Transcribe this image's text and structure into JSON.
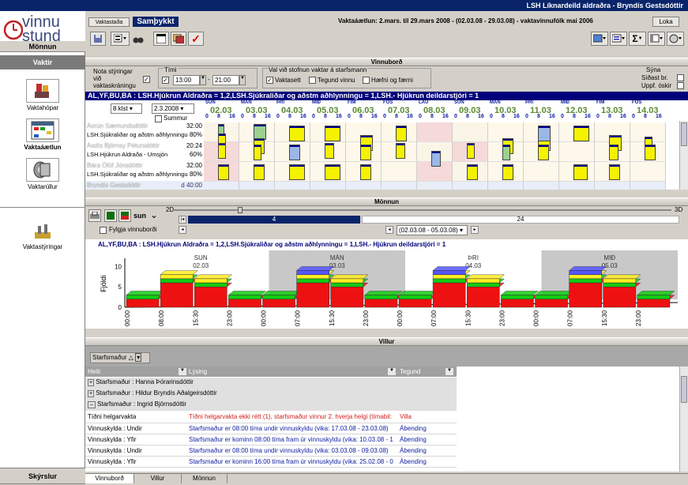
{
  "title": "LSH Líknardeild aldraðra - Bryndís Gestsdóttir",
  "logo": {
    "line1": "vinnu",
    "line2": "stund"
  },
  "nav": {
    "head1": "Mönnun",
    "head2": "Vaktir",
    "items": [
      {
        "label": "Vaktahópar",
        "icon": "people-icon"
      },
      {
        "label": "Vaktaáætlun",
        "icon": "calendar-icon"
      },
      {
        "label": "Vaktarúllur",
        "icon": "roll-icon"
      },
      {
        "label": "Vaktastýringar",
        "icon": "settings-icon"
      }
    ],
    "footer": "Skýrslur"
  },
  "toolbar": {
    "tab_vaktastada": "Vaktastaða",
    "tab_sambykkt": "Samþykkt",
    "plan_info": "Vaktaáætlun: 2.mars. til 29.mars 2008 - (02.03.08 - 29.03.08) - vaktavinnufólk mai 2006",
    "loka": "Loka"
  },
  "vinnubord": {
    "title": "Vinnuborð",
    "nota_styringar": "Nota stýringar við vaktaskráningu",
    "timi_label": "Tími",
    "time_from": "13:00",
    "time_to": "21:00",
    "val_label": "Val við stofnun vaktar á starfsmann",
    "vaktasett": "Vaktasett",
    "tegund_vinnu": "Tegund vinnu",
    "haefni": "Hæfni og færni",
    "syna_label": "Sýna",
    "sidast": "Síðast br.",
    "uppf": "Uppf. óskir",
    "bluebar": "AL,YF,BU,BA : LSH.Hjúkrun Aldraðra = 1,2,LSH.Sjúkraliðar og aðstm aðhlynningu = 1,LSH.- Hjúkrun deildarstjóri = 1",
    "period": "8 klst",
    "date": "2.3.2008",
    "summur": "Summur",
    "days": [
      {
        "d": "SUN",
        "n": "02.03"
      },
      {
        "d": "MÁN",
        "n": "03.03"
      },
      {
        "d": "ÞRI",
        "n": "04.03"
      },
      {
        "d": "MIÐ",
        "n": "05.03"
      },
      {
        "d": "FIM",
        "n": "06.03"
      },
      {
        "d": "FÖS",
        "n": "07.03"
      },
      {
        "d": "LAU",
        "n": "08.03"
      },
      {
        "d": "SUN",
        "n": "09.03"
      },
      {
        "d": "MÁN",
        "n": "10.03"
      },
      {
        "d": "ÞRI",
        "n": "11.03"
      },
      {
        "d": "MIÐ",
        "n": "12.03"
      },
      {
        "d": "FIM",
        "n": "13.03"
      },
      {
        "d": "FÖS",
        "n": "14.03"
      }
    ],
    "rows": [
      {
        "name": "Ásrún Sæmundsdóttir",
        "hours": "32:00",
        "group": "LSH.Sjúkraliðar og aðstm aðhlynningu",
        "pct": "80%"
      },
      {
        "name": "Ásdís Björnsy Pétursdóttir",
        "hours": "20:24",
        "group": "LSH.Hjúkrun Aldraða - Umsjón",
        "pct": "60%"
      },
      {
        "name": "Bára Ólöf Jónsdóttir",
        "hours": "32:00",
        "group": "LSH.Sjúkraliðar og aðstm aðhlynningu",
        "pct": "80%"
      },
      {
        "name": "Bryndís Gestsdóttir",
        "hours": "d 40:00",
        "group": "",
        "pct": ""
      }
    ]
  },
  "monnun": {
    "title": "Mönnun",
    "sun_label": "sun",
    "slider_min": "2D",
    "slider_max": "3D",
    "num_a": "4",
    "num_b": "24",
    "fylgja": "Fylgja vinnuborði",
    "range": "(02.03.08 - 05.03.08)",
    "chart_title": "AL,YF,BU,BA : LSH.Hjúkrun Aldraðra = 1,2,LSH.Sjúkraliðar og aðstm aðhlynningu = 1,LSH.- Hjúkrun deildarstjóri = 1",
    "ylabel": "Fjöldi",
    "yticks": [
      "0",
      "5",
      "10"
    ],
    "xticks": [
      "00:00",
      "08:00",
      "15:30",
      "23:00",
      "00:00",
      "07:00",
      "15:30",
      "23:00",
      "00:00",
      "07:00",
      "15:30",
      "23:00",
      "00:00",
      "07:00",
      "15:30",
      "23:00"
    ]
  },
  "chart_data": {
    "type": "area",
    "title": "AL,YF,BU,BA : LSH.Hjúkrun Aldraðra = 1,2,LSH.Sjúkraliðar og aðstm aðhlynningu = 1,LSH.- Hjúkrun deildarstjóri = 1",
    "ylabel": "Fjöldi",
    "ylim": [
      0,
      12
    ],
    "days": [
      {
        "d": "SUN",
        "n": "02.03"
      },
      {
        "d": "MÁN",
        "n": "03.03"
      },
      {
        "d": "ÞRI",
        "n": "04.03"
      },
      {
        "d": "MIÐ",
        "n": "05.03"
      }
    ],
    "series": [
      {
        "values": [
          2,
          6,
          5,
          2,
          2,
          6,
          5,
          2,
          2,
          6,
          5,
          2,
          2,
          6,
          5,
          2
        ]
      },
      {
        "values": [
          1,
          1,
          1,
          1,
          1,
          1,
          1,
          1,
          1,
          1,
          1,
          1,
          1,
          1,
          1,
          1
        ]
      },
      {
        "values": [
          0,
          1,
          1,
          0,
          0,
          1,
          1,
          0,
          0,
          1,
          1,
          0,
          0,
          1,
          1,
          0
        ]
      },
      {
        "values": [
          0,
          0,
          0,
          0,
          0,
          1,
          0,
          0,
          0,
          1,
          0,
          0,
          0,
          1,
          0,
          0
        ]
      }
    ],
    "colors": [
      "#ee1111",
      "#11cc11",
      "#ffee22",
      "#5555ff"
    ]
  },
  "villur": {
    "title": "Villur",
    "group_select": "Starfsmaður",
    "columns": [
      "Heiti",
      "Lýsing",
      "Tegund"
    ],
    "groups": [
      "Starfsmaður : Hanna Þórarinsdóttir",
      "Starfsmaður : Hildur Bryndís Aðalgeirsdóttir",
      "Starfsmaður : Ingrid Björnsdóttir"
    ],
    "rows": [
      {
        "heiti": "Tíðni helgarvakta",
        "lysing": "Tíðni helgarvakta ekki rétt (1), starfsmaður vinnur 2. hverja helgi (tímabil:",
        "tegund": "Villa",
        "kind": "error"
      },
      {
        "heiti": "Vinnuskylda : Undir",
        "lysing": "Starfsmaður er 08:00 tíma undir vinnuskyldu (vika: 17.03.08 - 23.03.08)",
        "tegund": "Ábending",
        "kind": "note"
      },
      {
        "heiti": "Vinnuskylda : Yfir",
        "lysing": "Starfsmaður er kominn 08:00 tíma fram úr vinnuskyldu (vika: 10.03.08 - 1",
        "tegund": "Ábending",
        "kind": "note"
      },
      {
        "heiti": "Vinnuskylda : Undir",
        "lysing": "Starfsmaður er 08:00 tíma undir vinnuskyldu (vika: 03.03.08 - 09.03.08)",
        "tegund": "Ábending",
        "kind": "note"
      },
      {
        "heiti": "Vinnuskylda : Yfir",
        "lysing": "Starfsmaður er kominn 16:00 tíma fram úr vinnuskyldu (vika: 25.02.08 - 0",
        "tegund": "Ábending",
        "kind": "note"
      }
    ]
  },
  "bottom_tabs": [
    "Vinnuborð",
    "Villur",
    "Mönnun"
  ]
}
